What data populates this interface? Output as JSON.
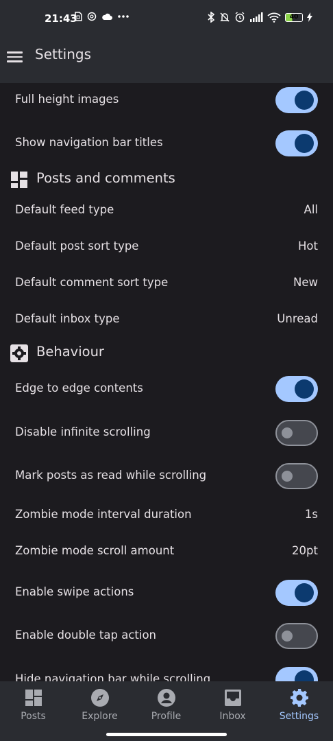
{
  "status_bar": {
    "time": "21:43",
    "left_icons": [
      "sim-icon",
      "threads-icon",
      "cloud-icon",
      "more-dots-icon"
    ],
    "right_icons": [
      "bluetooth-icon",
      "mute-bell-icon",
      "alarm-icon",
      "signal-icon",
      "wifi-icon",
      "battery-icon",
      "charging-bolt-icon"
    ],
    "battery_level": "40"
  },
  "header": {
    "menu_icon": "hamburger-icon",
    "title": "Settings"
  },
  "settings": {
    "full_height_images": {
      "label": "Full height images",
      "on": true
    },
    "show_nav_titles": {
      "label": "Show navigation bar titles",
      "on": true
    },
    "posts_section": {
      "icon": "dashboard-icon",
      "title": "Posts and comments"
    },
    "default_feed": {
      "label": "Default feed type",
      "value": "All"
    },
    "default_post_sort": {
      "label": "Default post sort type",
      "value": "Hot"
    },
    "default_comment_sort": {
      "label": "Default comment sort type",
      "value": "New"
    },
    "default_inbox": {
      "label": "Default inbox type",
      "value": "Unread"
    },
    "behaviour_section": {
      "icon": "gear-icon",
      "title": "Behaviour"
    },
    "edge_to_edge": {
      "label": "Edge to edge contents",
      "on": true
    },
    "disable_infinite": {
      "label": "Disable infinite scrolling",
      "on": false
    },
    "mark_read": {
      "label": "Mark posts as read while scrolling",
      "on": false
    },
    "zombie_interval": {
      "label": "Zombie mode interval duration",
      "value": "1s"
    },
    "zombie_scroll": {
      "label": "Zombie mode scroll amount",
      "value": "20pt"
    },
    "swipe_actions": {
      "label": "Enable swipe actions",
      "on": true
    },
    "double_tap": {
      "label": "Enable double tap action",
      "on": false
    },
    "hide_nav": {
      "label": "Hide navigation bar while scrolling",
      "on": true
    }
  },
  "bottom_nav": {
    "posts": {
      "label": "Posts",
      "icon": "posts-grid-icon"
    },
    "explore": {
      "label": "Explore",
      "icon": "compass-icon"
    },
    "profile": {
      "label": "Profile",
      "icon": "account-circle-icon"
    },
    "inbox": {
      "label": "Inbox",
      "icon": "inbox-tray-icon"
    },
    "settings": {
      "label": "Settings",
      "icon": "settings-gear-icon",
      "active": true
    }
  },
  "colors": {
    "background": "#1c1b1f",
    "bar_background": "#2a2c31",
    "toggle_on_track": "#a4c8ff",
    "toggle_on_thumb": "#0c3a6f",
    "toggle_off_track": "#45474e",
    "active_nav": "#a4c8ff"
  }
}
